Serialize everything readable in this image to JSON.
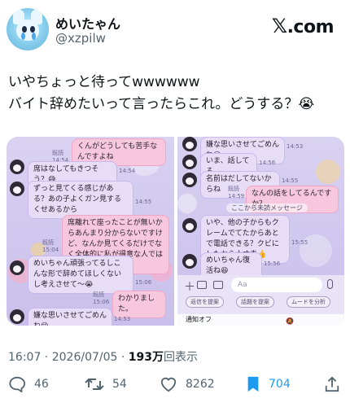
{
  "author": {
    "name": "めいたゃん",
    "handle": "@xzpilw"
  },
  "brand": {
    "mark": "𝕏",
    "text": ".com"
  },
  "tweet": {
    "line1": "いやちょっと待ってwwwwww",
    "line2": "バイト辞めたいって言ったらこれ。どうする？😭"
  },
  "chat_left": {
    "m1": "くんがどうしても苦手なんですよね",
    "m1_read": "既読",
    "m1_time": "14:54",
    "m2": "席はなしてもきつそう？😅",
    "m2_time": "14:54",
    "m3": "ずっと見てくる感じがある？あの子よくガン見するくせあるから",
    "m3_time": "14:55",
    "m4": "席離れて座ったことが無いからあんまり分からないですけど、なんか見てくるだけでなく全体的に私が得意な人ではなくて😅笑",
    "m4_read": "既読",
    "m4_time": "15:04",
    "m5": "めいちゃん頑張ってるしこんな形で辞めてほしくないし考えさせて〜😭",
    "m5_time": "15:06",
    "m6": "わかりました。",
    "m6_read": "既読",
    "m6_time": "15:06",
    "m7": "嫌な思いさせてごめんね😔",
    "m7_time": "14:53"
  },
  "chat_right": {
    "m1": "嫌な思いさせてごめんね😔",
    "m1_time": "14:53",
    "m2": "いま、話してる",
    "m2_time": "14:56",
    "m3": "名前はだしてないからね",
    "m3_time": "14:55",
    "m4": "なんの話をしてるんですか？",
    "m4_read": "既読",
    "m4_time": "14:59",
    "divider": "ここから未読メッセージ",
    "m5": "いや、他の子からもクレームでてたからあとで電話できる？クビにしたから大丈夫👍",
    "m5_time": "15:55",
    "m6": "めいちゃん復活ね😆",
    "m6_time": "15:56",
    "input_placeholder": "Aa",
    "pill1": "返信を提案",
    "pill2": "話題を提案",
    "pill3": "ムードを分析",
    "notice": "通知オフ"
  },
  "meta": {
    "time": "16:07",
    "date": "2026/07/05",
    "views": "193万",
    "views_label": "回表示"
  },
  "actions": {
    "replies": "46",
    "reposts": "54",
    "likes": "8262",
    "bookmarks": "704"
  },
  "colors": {
    "accent": "#1d9bf0",
    "muted": "#536471",
    "text": "#0f1419",
    "chat_bg": "#d0c8ee",
    "bubble_out": "#f7c8dd",
    "bubble_in": "#e7ddf7"
  }
}
